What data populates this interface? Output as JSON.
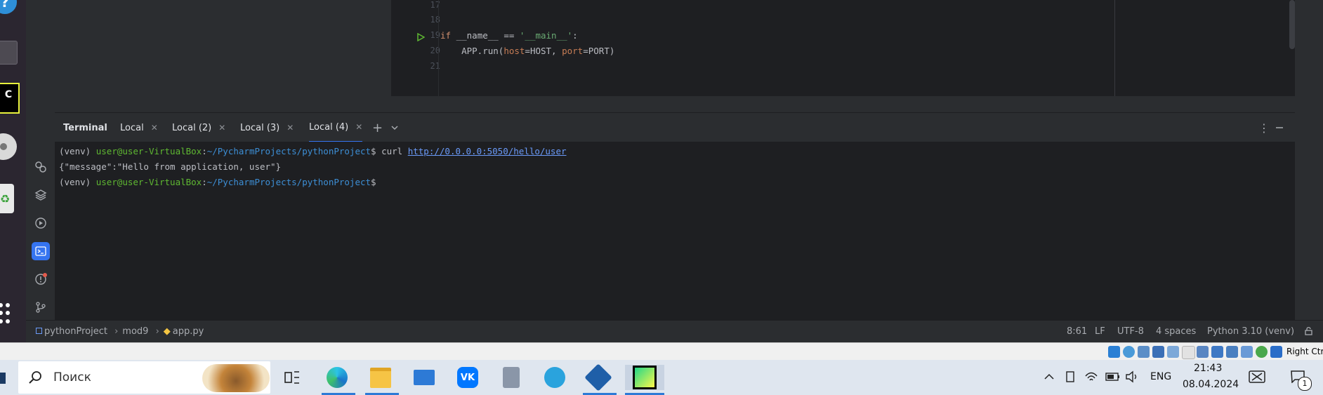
{
  "editor": {
    "lines": [
      {
        "num": "17",
        "text": ""
      },
      {
        "num": "18",
        "text": ""
      },
      {
        "num": "19",
        "kw": "if",
        "rest1": " __name__ == ",
        "str": "'__main__'",
        "rest2": ":"
      },
      {
        "num": "20",
        "pre": "    APP.run(",
        "p1": "host",
        "eq1": "=HOST, ",
        "p2": "port",
        "eq2": "=PORT)"
      },
      {
        "num": "21",
        "text": ""
      }
    ]
  },
  "terminal": {
    "title": "Terminal",
    "tabs": [
      "Local",
      "Local (2)",
      "Local (3)",
      "Local (4)"
    ],
    "active_tab": "Local (4)",
    "lines": [
      {
        "venv": "(venv) ",
        "user": "user@user-VirtualBox",
        "colon": ":",
        "path": "~/PycharmProjects/pythonProject",
        "prompt": "$ ",
        "cmd": "curl ",
        "link": "http://0.0.0.0:5050/hello/user"
      },
      {
        "output": "{\"message\":\"Hello from application, user\"}"
      },
      {
        "venv": "(venv) ",
        "user": "user@user-VirtualBox",
        "colon": ":",
        "path": "~/PycharmProjects/pythonProject",
        "prompt": "$"
      }
    ]
  },
  "status_bar": {
    "breadcrumb": [
      "pythonProject",
      "mod9",
      "app.py"
    ],
    "position": "8:61",
    "line_sep": "LF",
    "encoding": "UTF-8",
    "indent": "4 spaces",
    "interpreter": "Python 3.10 (venv)"
  },
  "vbox": {
    "host_key": "Right Ctrl"
  },
  "taskbar": {
    "search_placeholder": "Поиск",
    "language": "ENG",
    "time": "21:43",
    "date": "08.04.2024",
    "notification_count": "1"
  },
  "colors": {
    "keyword": "#cf8e6d",
    "string": "#6aab73",
    "param": "#c77d55",
    "user": "#5fb832",
    "path": "#3d8fd6",
    "link": "#6b9bfa",
    "accent": "#3574f0"
  }
}
